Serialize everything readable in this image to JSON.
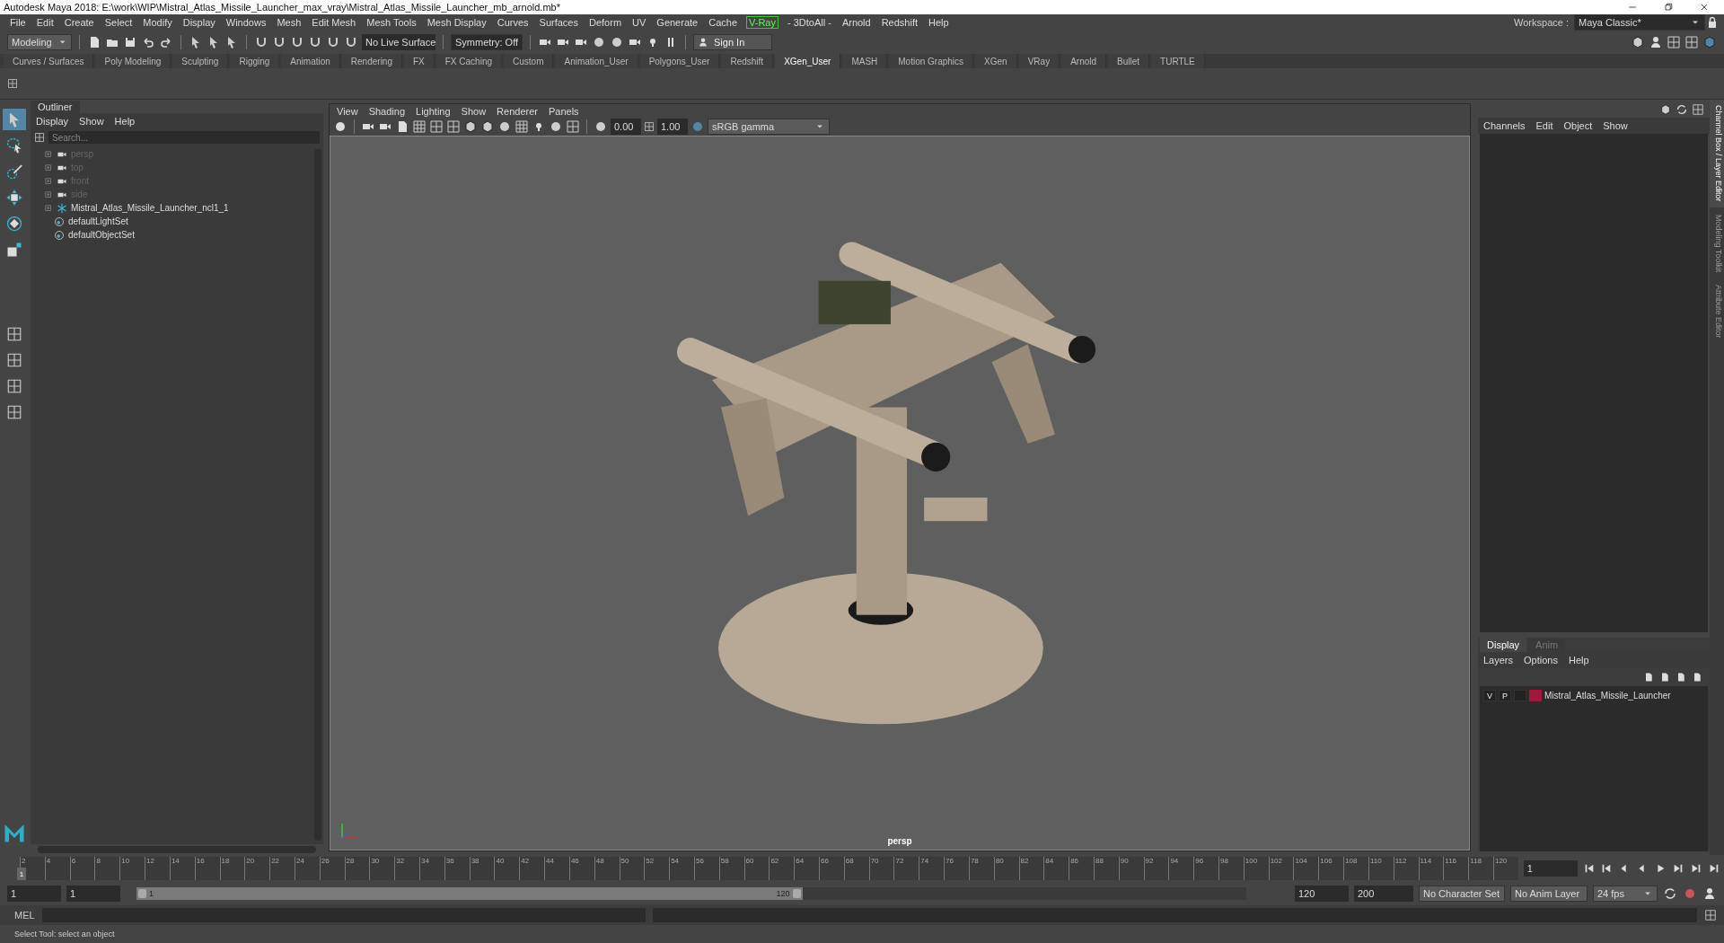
{
  "window": {
    "title": "Autodesk Maya 2018: E:\\work\\WIP\\Mistral_Atlas_Missile_Launcher_max_vray\\Mistral_Atlas_Missile_Launcher_mb_arnold.mb*"
  },
  "menu": [
    {
      "label": "File",
      "kind": "plain"
    },
    {
      "label": "Edit",
      "kind": "plain"
    },
    {
      "label": "Create",
      "kind": "plain"
    },
    {
      "label": "Select",
      "kind": "plain"
    },
    {
      "label": "Modify",
      "kind": "plain"
    },
    {
      "label": "Display",
      "kind": "plain"
    },
    {
      "label": "Windows",
      "kind": "plain"
    },
    {
      "label": "Mesh",
      "kind": "plain"
    },
    {
      "label": "Edit Mesh",
      "kind": "plain"
    },
    {
      "label": "Mesh Tools",
      "kind": "plain"
    },
    {
      "label": "Mesh Display",
      "kind": "plain"
    },
    {
      "label": "Curves",
      "kind": "plain"
    },
    {
      "label": "Surfaces",
      "kind": "plain"
    },
    {
      "label": "Deform",
      "kind": "plain"
    },
    {
      "label": "UV",
      "kind": "plain"
    },
    {
      "label": "Generate",
      "kind": "plain"
    },
    {
      "label": "Cache",
      "kind": "plain"
    },
    {
      "label": "V-Ray",
      "kind": "plugin"
    },
    {
      "label": "- 3DtoAll -",
      "kind": "plain"
    },
    {
      "label": "Arnold",
      "kind": "plain"
    },
    {
      "label": "Redshift",
      "kind": "plain"
    },
    {
      "label": "Help",
      "kind": "plain"
    }
  ],
  "toolbar": {
    "mode": "Modeling",
    "live_surface": "No Live Surface",
    "symmetry": "Symmetry: Off",
    "sign_in": "Sign In"
  },
  "workspace": {
    "label": "Workspace :",
    "value": "Maya Classic*"
  },
  "shelf_tabs": [
    {
      "label": "Curves / Surfaces",
      "selected": false
    },
    {
      "label": "Poly Modeling",
      "selected": false
    },
    {
      "label": "Sculpting",
      "selected": false
    },
    {
      "label": "Rigging",
      "selected": false
    },
    {
      "label": "Animation",
      "selected": false
    },
    {
      "label": "Rendering",
      "selected": false
    },
    {
      "label": "FX",
      "selected": false
    },
    {
      "label": "FX Caching",
      "selected": false
    },
    {
      "label": "Custom",
      "selected": false
    },
    {
      "label": "Animation_User",
      "selected": false
    },
    {
      "label": "Polygons_User",
      "selected": false
    },
    {
      "label": "Redshift",
      "selected": false
    },
    {
      "label": "XGen_User",
      "selected": true
    },
    {
      "label": "MASH",
      "selected": false
    },
    {
      "label": "Motion Graphics",
      "selected": false
    },
    {
      "label": "XGen",
      "selected": false
    },
    {
      "label": "VRay",
      "selected": false
    },
    {
      "label": "Arnold",
      "selected": false
    },
    {
      "label": "Bullet",
      "selected": false
    },
    {
      "label": "TURTLE",
      "selected": false
    }
  ],
  "outliner": {
    "title": "Outliner",
    "menu": [
      "Display",
      "Show",
      "Help"
    ],
    "search": {
      "placeholder": "Search..."
    },
    "items": [
      {
        "label": "persp",
        "kind": "camera",
        "hidden": true
      },
      {
        "label": "top",
        "kind": "camera",
        "hidden": true
      },
      {
        "label": "front",
        "kind": "camera",
        "hidden": true
      },
      {
        "label": "side",
        "kind": "camera",
        "hidden": true
      },
      {
        "label": "Mistral_Atlas_Missile_Launcher_ncl1_1",
        "kind": "group",
        "hidden": false
      },
      {
        "label": "defaultLightSet",
        "kind": "set",
        "hidden": false
      },
      {
        "label": "defaultObjectSet",
        "kind": "set",
        "hidden": false
      }
    ]
  },
  "viewport": {
    "menu": [
      "View",
      "Shading",
      "Lighting",
      "Show",
      "Renderer",
      "Panels"
    ],
    "exposure": "0.00",
    "gamma": "1.00",
    "color_space": "sRGB gamma",
    "camera": "persp"
  },
  "channel_box": {
    "menu": [
      "Channels",
      "Edit",
      "Object",
      "Show"
    ],
    "side_tabs": [
      {
        "label": "Channel Box / Layer Editor",
        "selected": true
      },
      {
        "label": "Modeling Toolkit",
        "selected": false
      },
      {
        "label": "Attribute Editor",
        "selected": false
      }
    ],
    "layer_tabs": [
      {
        "label": "Display",
        "selected": true
      },
      {
        "label": "Anim",
        "selected": false
      }
    ],
    "layer_menu": [
      "Layers",
      "Options",
      "Help"
    ],
    "layers": [
      {
        "visible": "V",
        "playback": "P",
        "color": "#a3173a",
        "name": "Mistral_Atlas_Missile_Launcher"
      }
    ]
  },
  "timeline": {
    "current": "1",
    "ticks": [
      "2",
      "4",
      "6",
      "8",
      "10",
      "12",
      "14",
      "16",
      "18",
      "20",
      "22",
      "24",
      "26",
      "28",
      "30",
      "32",
      "34",
      "36",
      "38",
      "40",
      "42",
      "44",
      "46",
      "48",
      "50",
      "52",
      "54",
      "56",
      "58",
      "60",
      "62",
      "64",
      "66",
      "68",
      "70",
      "72",
      "74",
      "76",
      "78",
      "80",
      "82",
      "84",
      "86",
      "88",
      "90",
      "92",
      "94",
      "96",
      "98",
      "100",
      "102",
      "104",
      "106",
      "108",
      "110",
      "112",
      "114",
      "116",
      "118",
      "120"
    ],
    "frame": "1",
    "level": 0
  },
  "range": {
    "level": 0.6,
    "start": "1",
    "playback_start": "1",
    "slider_start": "1",
    "slider_end": "120",
    "playback_end": "120",
    "end": "200",
    "character_set": "No Character Set",
    "anim_layer": "No Anim Layer",
    "fps": "24 fps"
  },
  "command_line": {
    "label": "MEL"
  },
  "help_line": "Select Tool: select an object"
}
